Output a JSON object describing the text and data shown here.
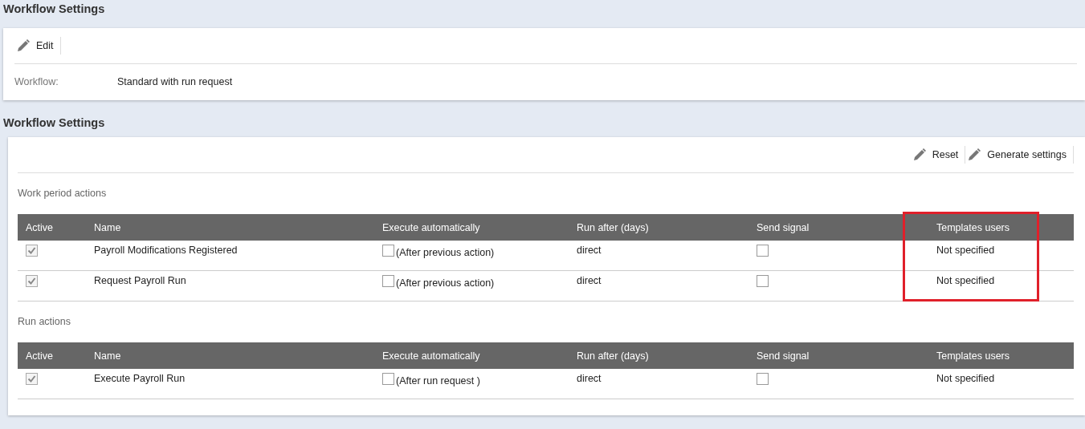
{
  "sections": [
    {
      "title": "Workflow Settings",
      "toolbar": [
        {
          "label": "Edit"
        }
      ],
      "fields": [
        {
          "label": "Workflow:",
          "value": "Standard with run request"
        }
      ]
    },
    {
      "title": "Workflow Settings",
      "toolbar": [
        {
          "label": "Reset"
        },
        {
          "label": "Generate settings"
        }
      ],
      "groups": [
        {
          "title": "Work period actions",
          "columns": [
            {
              "label": "Active",
              "highlighted": false
            },
            {
              "label": "Name",
              "highlighted": false
            },
            {
              "label": "Execute automatically",
              "highlighted": false
            },
            {
              "label": "Run after (days)",
              "highlighted": false
            },
            {
              "label": "Send signal",
              "highlighted": false
            },
            {
              "label": "Templates users",
              "highlighted": true
            }
          ],
          "rows": [
            {
              "active": true,
              "name": "Payroll Modifications Registered",
              "execute_automatically": false,
              "execute_note": "(After previous action)",
              "run_after": "direct",
              "send_signal": false,
              "templates_users": "Not specified"
            },
            {
              "active": true,
              "name": "Request Payroll Run",
              "execute_automatically": false,
              "execute_note": "(After previous action)",
              "run_after": "direct",
              "send_signal": false,
              "templates_users": "Not specified"
            }
          ]
        },
        {
          "title": "Run actions",
          "columns": [
            {
              "label": "Active",
              "highlighted": false
            },
            {
              "label": "Name",
              "highlighted": false
            },
            {
              "label": "Execute automatically",
              "highlighted": false
            },
            {
              "label": "Run after (days)",
              "highlighted": false
            },
            {
              "label": "Send signal",
              "highlighted": false
            },
            {
              "label": "Templates users",
              "highlighted": false
            }
          ],
          "rows": [
            {
              "active": true,
              "name": "Execute Payroll Run",
              "execute_automatically": false,
              "execute_note": "(After run request )",
              "run_after": "direct",
              "send_signal": false,
              "templates_users": "Not specified"
            }
          ]
        }
      ]
    }
  ]
}
